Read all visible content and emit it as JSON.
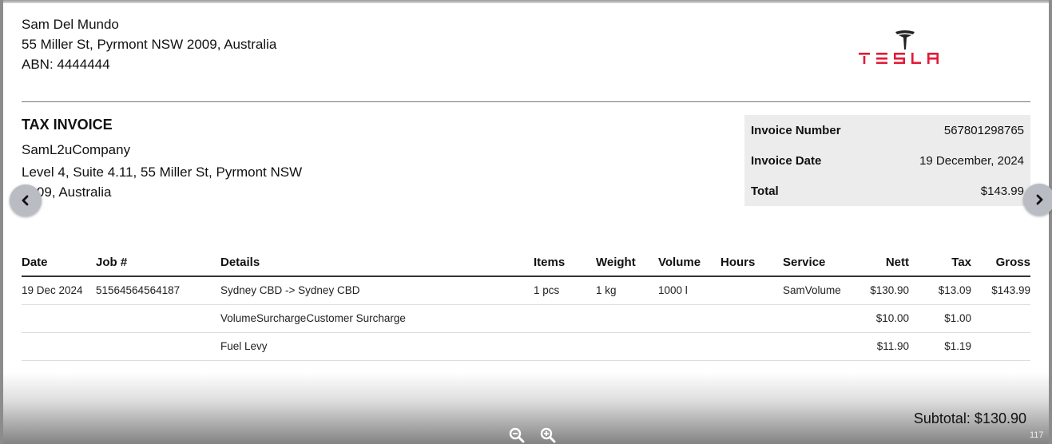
{
  "sender": {
    "name": "Sam Del Mundo",
    "address": "55 Miller St, Pyrmont NSW 2009, Australia",
    "abn": "ABN: 4444444"
  },
  "logo": {
    "text": "TESLA",
    "color": "#e31937"
  },
  "invoice": {
    "title": "TAX INVOICE",
    "company": "SamL2uCompany",
    "address_line1": "Level 4, Suite 4.11, 55 Miller St, Pyrmont NSW",
    "address_line2": "2009, Australia"
  },
  "meta": [
    {
      "label": "Invoice Number",
      "value": "567801298765"
    },
    {
      "label": "Invoice Date",
      "value": "19 December, 2024"
    },
    {
      "label": "Total",
      "value": "$143.99"
    }
  ],
  "table": {
    "headers": [
      "Date",
      "Job #",
      "Details",
      "Items",
      "Weight",
      "Volume",
      "Hours",
      "Service",
      "Nett",
      "Tax",
      "Gross"
    ],
    "rows": [
      [
        "19 Dec 2024",
        "51564564564187",
        "Sydney CBD -> Sydney CBD",
        "1 pcs",
        "1 kg",
        "1000 l",
        "",
        "SamVolume",
        "$130.90",
        "$13.09",
        "$143.99"
      ],
      [
        "",
        "",
        "VolumeSurchargeCustomer Surcharge",
        "",
        "",
        "",
        "",
        "",
        "$10.00",
        "$1.00",
        ""
      ],
      [
        "",
        "",
        "Fuel Levy",
        "",
        "",
        "",
        "",
        "",
        "$11.90",
        "$1.19",
        ""
      ]
    ]
  },
  "footer": {
    "subtotal": "Subtotal: $130.90",
    "page_indicator": "117"
  },
  "icons": {
    "zoom_out": "zoom-out-icon",
    "zoom_in": "zoom-in-icon",
    "prev": "chevron-left-icon",
    "next": "chevron-right-icon"
  }
}
